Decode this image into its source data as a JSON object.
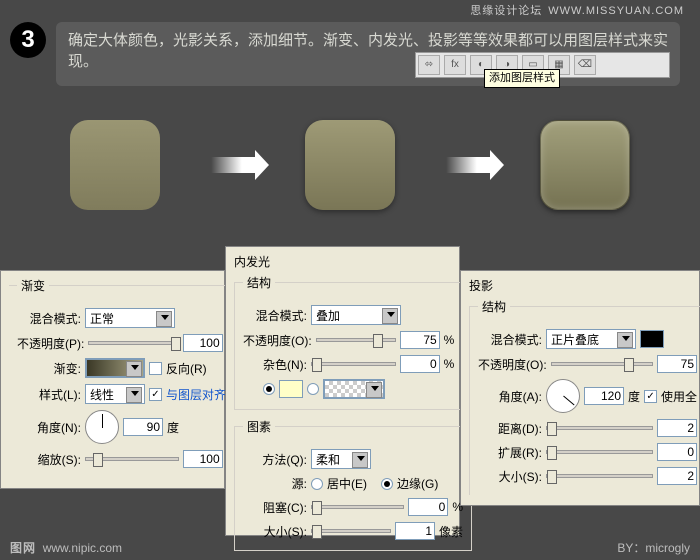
{
  "watermark": {
    "site": "思缘设计论坛",
    "url": "WWW.MISSYUAN.COM"
  },
  "step": "3",
  "instruction": "确定大体颜色，光影关系，添加细节。渐变、内发光、投影等等效果都可以用图层样式来实现。",
  "tooltip": "添加图层样式",
  "gradient": {
    "title": "渐变",
    "blend_label": "混合模式:",
    "blend_value": "正常",
    "opacity_label": "不透明度(P):",
    "opacity_value": "100",
    "pct": "%",
    "grad_label": "渐变:",
    "reverse_label": "反向(R)",
    "style_label": "样式(L):",
    "style_value": "线性",
    "align_label": "与图层对齐(I)",
    "angle_label": "角度(N):",
    "angle_value": "90",
    "deg": "度",
    "scale_label": "缩放(S):",
    "scale_value": "100"
  },
  "innerglow": {
    "title": "内发光",
    "group_struct": "结构",
    "blend_label": "混合模式:",
    "blend_value": "叠加",
    "opacity_label": "不透明度(O):",
    "opacity_value": "75",
    "pct": "%",
    "noise_label": "杂色(N):",
    "noise_value": "0",
    "group_elem": "图素",
    "method_label": "方法(Q):",
    "method_value": "柔和",
    "source_label": "源:",
    "src_center": "居中(E)",
    "src_edge": "边缘(G)",
    "choke_label": "阻塞(C):",
    "choke_value": "0",
    "size_label": "大小(S):",
    "size_value": "1",
    "px": "像素"
  },
  "shadow": {
    "title": "投影",
    "group_struct": "结构",
    "blend_label": "混合模式:",
    "blend_value": "正片叠底",
    "opacity_label": "不透明度(O):",
    "opacity_value": "75",
    "pct": "%",
    "angle_label": "角度(A):",
    "angle_value": "120",
    "deg": "度",
    "global_label": "使用全",
    "distance_label": "距离(D):",
    "distance_value": "2",
    "spread_label": "扩展(R):",
    "spread_value": "0",
    "size_label": "大小(S):",
    "size_value": "2"
  },
  "footer": {
    "logo": "图网",
    "url": "www.nipic.com",
    "by": "BY：microgly"
  }
}
